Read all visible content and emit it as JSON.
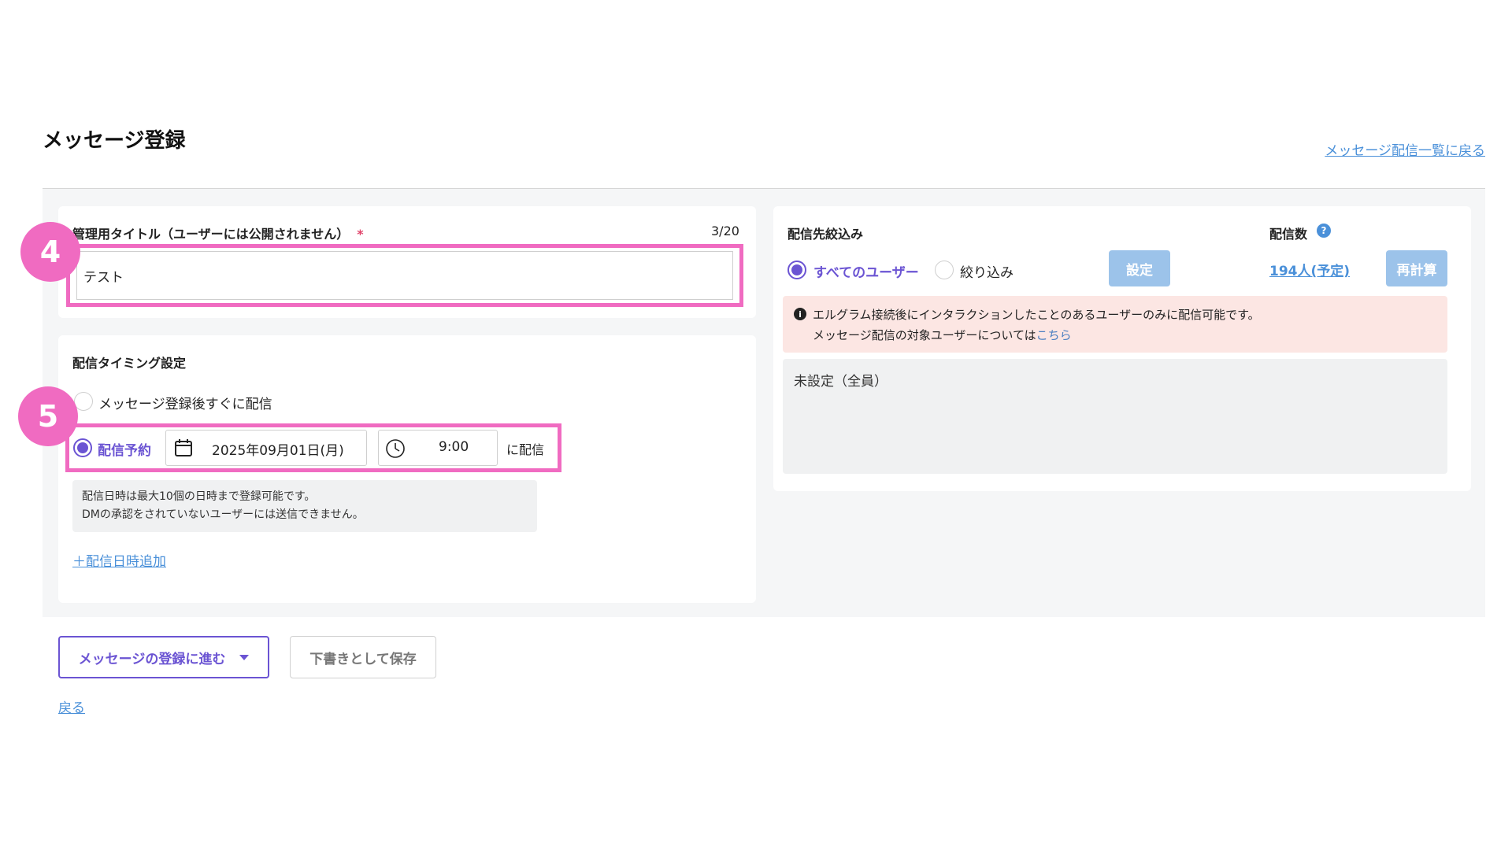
{
  "page": {
    "title": "メッセージ登録",
    "back_to_list": "メッセージ配信一覧に戻る"
  },
  "badges": {
    "step4": "4",
    "step5": "5"
  },
  "admin_title": {
    "label": "管理用タイトル（ユーザーには公開されません）",
    "required_mark": "*",
    "counter": "3/20",
    "value": "テスト"
  },
  "timing": {
    "heading": "配信タイミング設定",
    "option_immediate": "メッセージ登録後すぐに配信",
    "option_scheduled": "配信予約",
    "date_value": "2025年09月01日(月)",
    "time_value": "9:00",
    "suffix": "に配信",
    "note_line1": "配信日時は最大10個の日時まで登録可能です。",
    "note_line2": "DMの承認をされていないユーザーには送信できません。",
    "add_datetime": "＋配信日時追加"
  },
  "target": {
    "heading": "配信先絞込み",
    "option_all": "すべてのユーザー",
    "option_filter": "絞り込み",
    "setting_button": "設定",
    "count_heading": "配信数",
    "help_icon_glyph": "?",
    "count_value": "194人(予定)",
    "recalc_button": "再計算",
    "alert_icon_glyph": "i",
    "alert_line1": "エルグラム接続後にインタラクションしたことのあるユーザーのみに配信可能です。",
    "alert_line2_prefix": "メッセージ配信の対象ユーザーについては",
    "alert_link": "こちら",
    "filter_value": "未設定（全員）"
  },
  "actions": {
    "proceed": "メッセージの登録に進む",
    "save_draft": "下書きとして保存",
    "back": "戻る"
  },
  "colors": {
    "accent_purple": "#6b54d3",
    "highlight_pink": "#f06bc1",
    "link_blue": "#4a90d9",
    "disabled_button_blue": "#9cc3ea",
    "alert_background": "#fce6e3"
  }
}
